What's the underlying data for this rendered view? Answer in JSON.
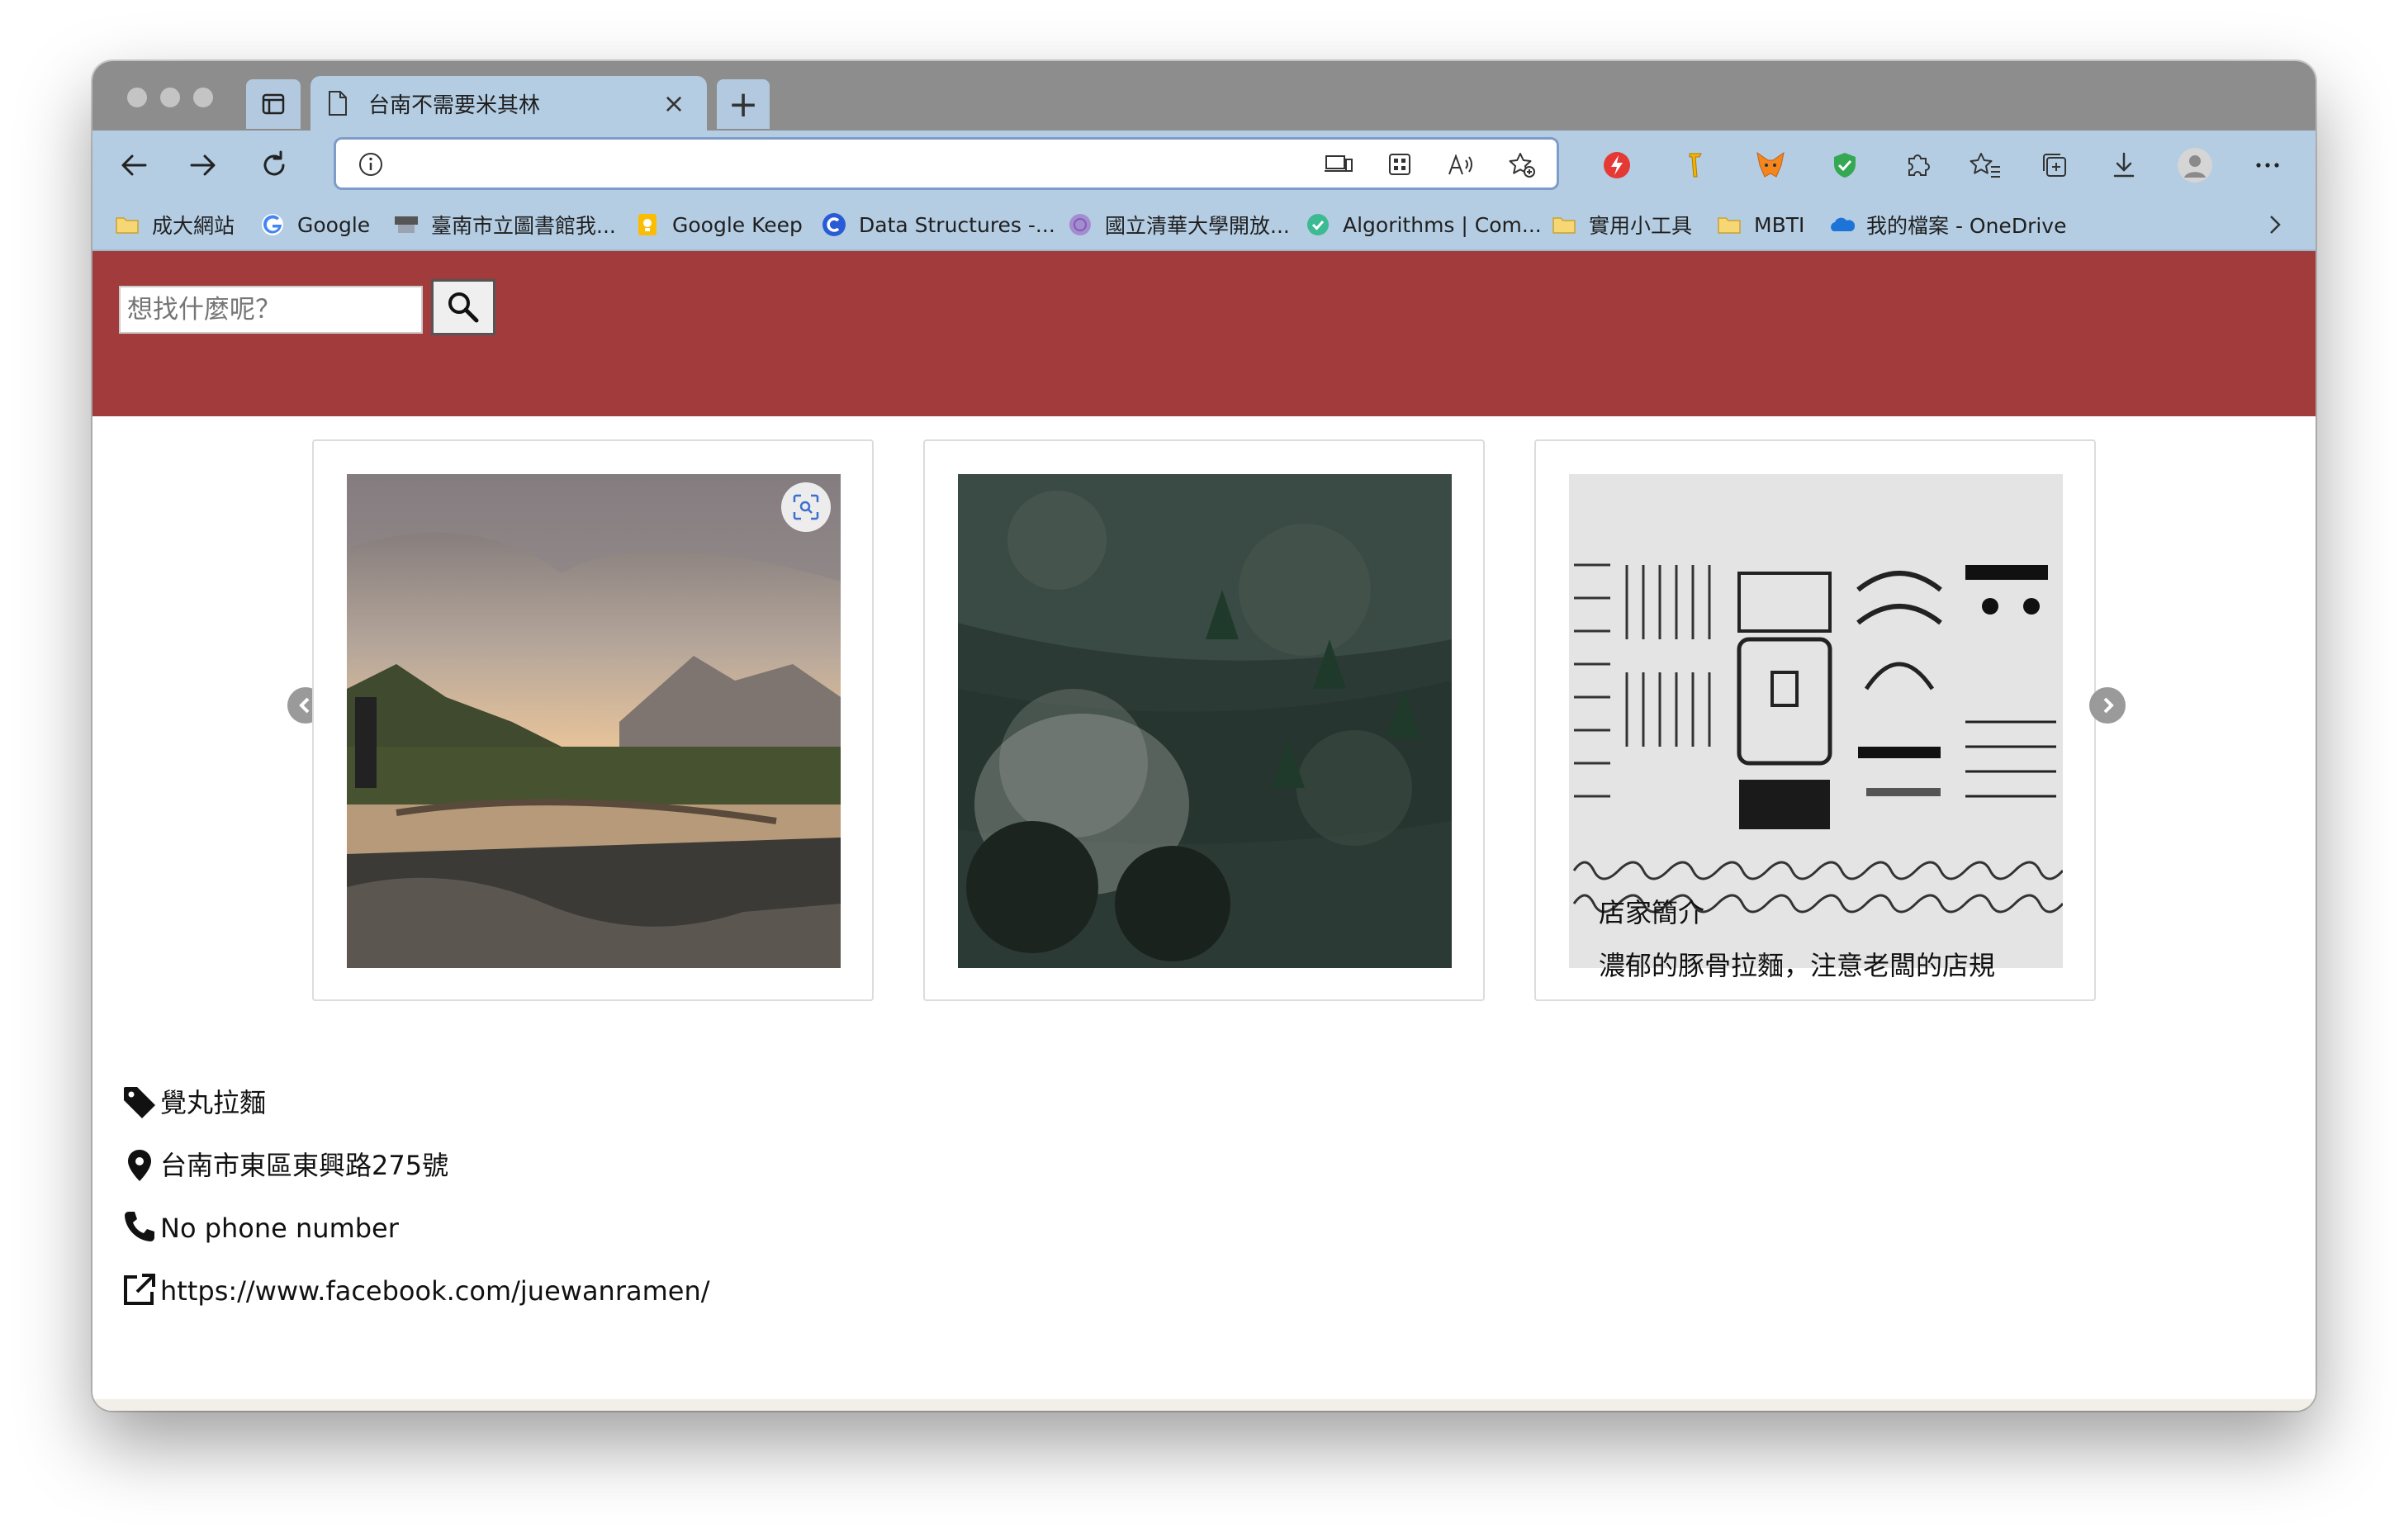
{
  "browser": {
    "tab": {
      "title": "台南不需要米其林",
      "close_glyph": "×"
    },
    "new_tab_glyph": "+",
    "address": {
      "url": ""
    },
    "bookmarks": [
      {
        "label": "成大網站",
        "icon": "folder-icon"
      },
      {
        "label": "Google",
        "icon": "google-icon"
      },
      {
        "label": "臺南市立圖書館我...",
        "icon": "library-icon"
      },
      {
        "label": "Google Keep",
        "icon": "keep-icon"
      },
      {
        "label": "Data Structures -...",
        "icon": "c-icon"
      },
      {
        "label": "國立清華大學開放...",
        "icon": "globe-icon"
      },
      {
        "label": "Algorithms | Com...",
        "icon": "check-icon"
      },
      {
        "label": "實用小工具",
        "icon": "folder-icon"
      },
      {
        "label": "MBTI",
        "icon": "folder-icon"
      },
      {
        "label": "我的檔案 - OneDrive",
        "icon": "onedrive-icon"
      }
    ]
  },
  "page": {
    "search": {
      "placeholder": "想找什麼呢？"
    },
    "store": {
      "name": "覺丸拉麵",
      "address": "台南市東區東興路275號",
      "phone": "No phone number",
      "link": "https://www.facebook.com/juewanramen/"
    },
    "intro": {
      "title": "店家簡介",
      "text": "濃郁的豚骨拉麵，注意老闆的店規"
    },
    "gallery": [
      {
        "image": "mountain-lake-sunset"
      },
      {
        "image": "forest-aerial"
      },
      {
        "image": "typewriter-parts"
      }
    ]
  },
  "colors": {
    "header_band": "#a23c3c",
    "chrome": "#b4cde3",
    "tabstrip": "#8d8d8d"
  }
}
